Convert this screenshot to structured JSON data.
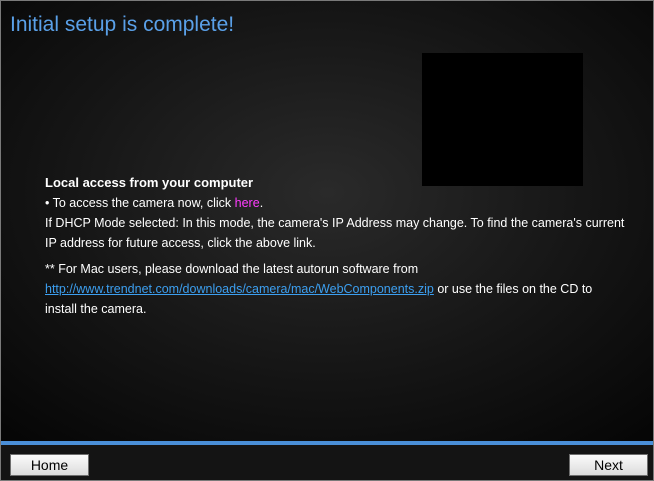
{
  "title": "Initial setup is complete!",
  "section": {
    "heading": "Local access from your computer",
    "access_prefix": "• To access the camera now, click ",
    "access_link": "here",
    "access_suffix": ".",
    "dhcp_text": "If DHCP Mode selected: In this mode, the camera's IP Address may change. To find the camera's current IP address for future access, click the above link.",
    "mac_prefix": "** For Mac users, please download the latest autorun software from",
    "mac_link": "http://www.trendnet.com/downloads/camera/mac/WebComponents.zip",
    "mac_suffix": " or use the files on the CD to install the camera."
  },
  "buttons": {
    "home": "Home",
    "next": "Next"
  },
  "colors": {
    "title": "#5aa0e8",
    "accent_line": "#4a8fd8",
    "here_link": "#ff3cff",
    "url_link": "#3c9ff0"
  }
}
